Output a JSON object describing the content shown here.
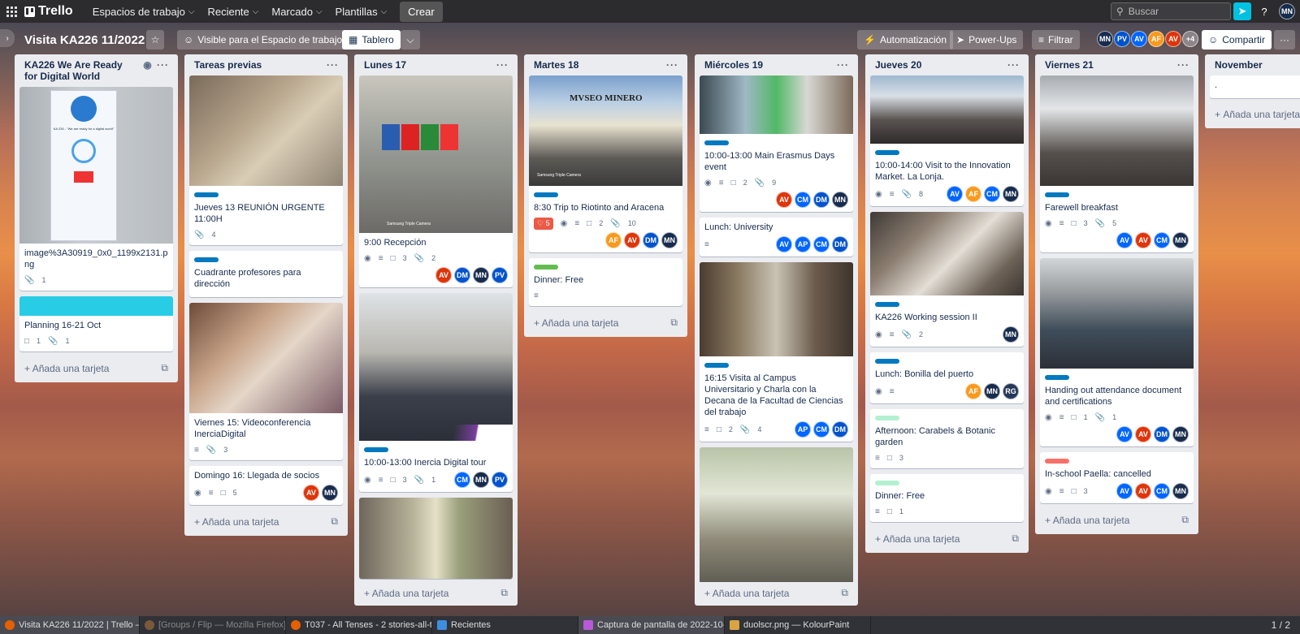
{
  "topbar": {
    "logo": "Trello",
    "menus": [
      "Espacios de trabajo",
      "Reciente",
      "Marcado",
      "Plantillas"
    ],
    "create": "Crear",
    "search_placeholder": "Buscar",
    "user": "MN"
  },
  "board": {
    "title": "Visita KA226 11/2022",
    "visibility": "Visible para el Espacio de trabajo",
    "view": "Tablero",
    "automation": "Automatización",
    "powerups": "Power-Ups",
    "filter": "Filtrar",
    "share": "Compartir",
    "more_members": "+4",
    "members": [
      {
        "initials": "MN",
        "color": "#172b4d"
      },
      {
        "initials": "PV",
        "color": "#0052cc"
      },
      {
        "initials": "AV",
        "color": "#0065ff"
      },
      {
        "initials": "AF",
        "color": "#f79a1e"
      },
      {
        "initials": "AV",
        "color": "#de350b"
      }
    ]
  },
  "add_card": "Añada una tarjeta",
  "lists": [
    {
      "title": "KA226 We Are Ready for Digital World"
    },
    {
      "title": "Tareas previas"
    },
    {
      "title": "Lunes 17"
    },
    {
      "title": "Martes 18"
    },
    {
      "title": "Miércoles 19"
    },
    {
      "title": "Jueves 20"
    },
    {
      "title": "Viernes 21"
    },
    {
      "title": "November"
    }
  ],
  "cards": {
    "c0a": {
      "title": "image%3A30919_0x0_1199x2131.png",
      "att": "1"
    },
    "c0b": {
      "title": "Planning 16-21 Oct",
      "com": "1",
      "att": "1"
    },
    "c1a": {
      "title": "Jueves 13 REUNIÓN URGENTE 11:00H",
      "att": "4"
    },
    "c1b": {
      "title": "Cuadrante profesores para dirección"
    },
    "c1c": {
      "title": "Viernes 15: Videoconferencia InerciaDigital",
      "att": "3"
    },
    "c1d": {
      "title": "Domingo 16: Llegada de socios",
      "com": "5"
    },
    "c2a": {
      "title": "9:00 Recepción",
      "com": "3",
      "att": "2"
    },
    "c2b": {
      "title": "10:00-13:00 Inercia Digital tour",
      "com": "3",
      "att": "1"
    },
    "c3a": {
      "title": "8:30 Trip to Riotinto and Aracena",
      "due": "5",
      "com": "2",
      "att": "10"
    },
    "c3b": {
      "title": "Dinner: Free"
    },
    "c4a": {
      "title": "10:00-13:00 Main Erasmus Days event",
      "com": "2",
      "att": "9"
    },
    "c4b": {
      "title": "Lunch: University"
    },
    "c4c": {
      "title": "16:15 Visita al Campus Universitario y Charla con la Decana de la Facultad de Ciencias del trabajo",
      "com": "2",
      "att": "4"
    },
    "c5a": {
      "title": "10:00-14:00 Visit to the Innovation Market. La Lonja.",
      "att": "8"
    },
    "c5b": {
      "title": "KA226 Working session II",
      "att": "2"
    },
    "c5c": {
      "title": "Lunch: Bonilla del puerto"
    },
    "c5d": {
      "title": "Afternoon: Carabels & Botanic garden",
      "com": "3"
    },
    "c5e": {
      "title": "Dinner: Free",
      "com": "1"
    },
    "c6a": {
      "title": "Farewell breakfast",
      "com": "3",
      "att": "5"
    },
    "c6b": {
      "title": "Handing out attendance document and certifications",
      "com": "1",
      "att": "1"
    },
    "c6c": {
      "title": "In-school Paella: cancelled",
      "com": "3"
    },
    "c7a": {
      "title": "."
    }
  },
  "cover_text": {
    "museo": "MVSEO MINERO",
    "camera": "Samsung Triple Camera",
    "rollup": "KA 226 - \"We are ready for a digital world\""
  },
  "taskbar": [
    "Visita KA226 11/2022 | Trello — ...",
    "[Groups / Flip — Mozilla Firefox]",
    "T037 - All Tenses - 2 stories-all-ten...",
    "Recientes",
    "Captura de pantalla de 2022-10-3...",
    "duolscr.png — KolourPaint"
  ],
  "pager": "1 / 2",
  "colors": {
    "blue_label": "#0079bf",
    "green_label": "#61bd4f",
    "teal_label": "#29cce5",
    "mint_label": "#b3f0d1",
    "red_label": "#f87168",
    "av": "#de350b",
    "af": "#f79a1e",
    "cm": "#0065ff",
    "dm": "#0052cc",
    "mn": "#172b4d",
    "pv": "#0052cc",
    "ap": "#0065ff",
    "rg": "#253858"
  }
}
